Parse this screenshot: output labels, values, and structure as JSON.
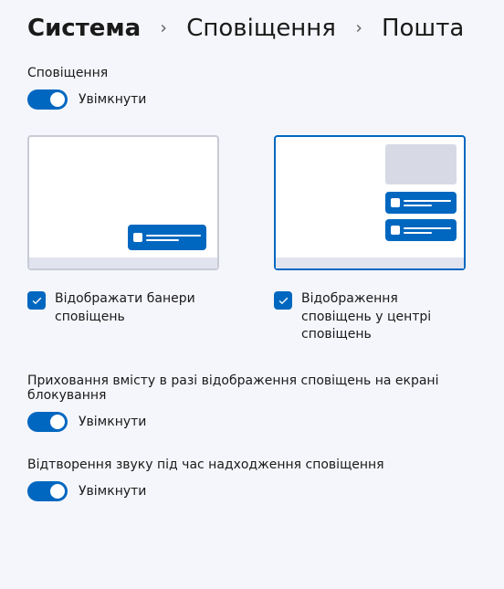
{
  "breadcrumb": {
    "system": "Система",
    "notifications": "Сповіщення",
    "mail": "Пошта"
  },
  "notifications": {
    "label": "Сповіщення",
    "toggle_label": "Увімкнути"
  },
  "options": {
    "show_banners": "Відображати банери сповіщень",
    "show_in_center": "Відображення сповіщень у центрі сповіщень"
  },
  "hide_content": {
    "label": "Приховання вмісту в разі відображення сповіщень на екрані блокування",
    "toggle_label": "Увімкнути"
  },
  "play_sound": {
    "label": "Відтворення звуку під час надходження сповіщення",
    "toggle_label": "Увімкнути"
  }
}
